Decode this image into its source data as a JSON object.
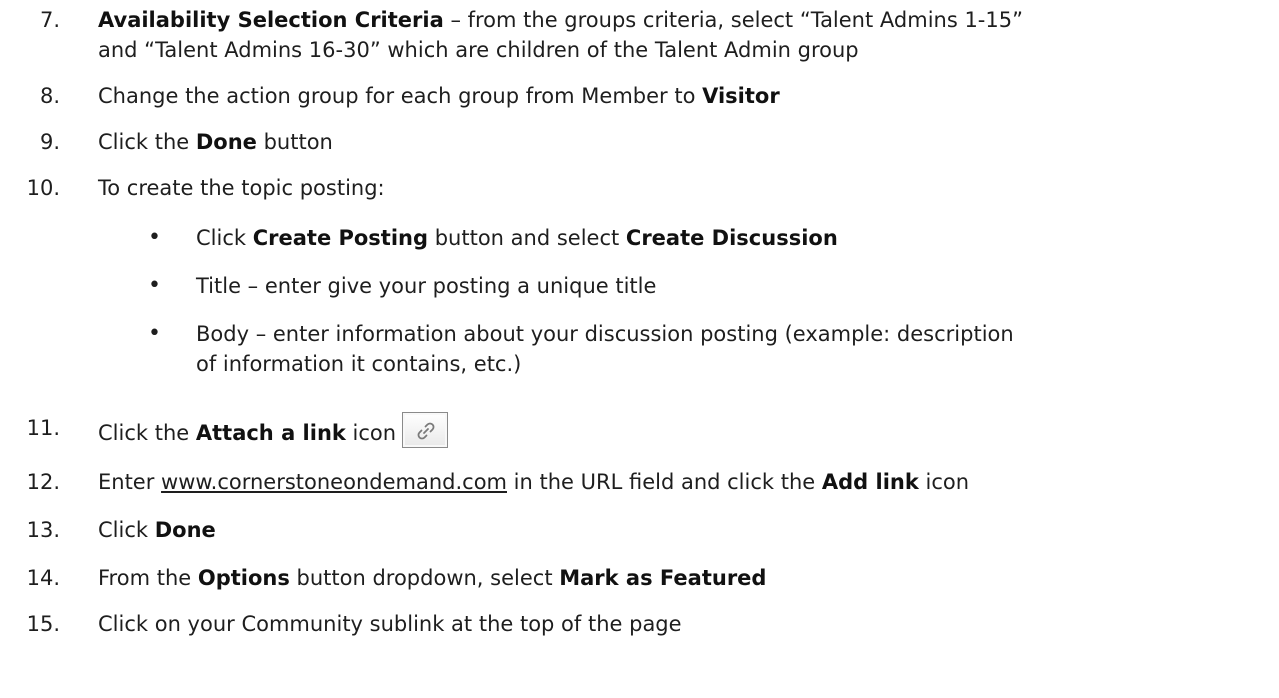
{
  "steps": [
    {
      "num": "7.",
      "bold": "Availability Selection Criteria",
      "rest_line1": " – from the groups criteria, select “Talent Admins 1-15”",
      "rest_line2": "and “Talent Admins 16-30” which are children of the Talent Admin group"
    },
    {
      "num": "8.",
      "pre": "Change the action group for each group from Member to ",
      "bold": "Visitor"
    },
    {
      "num": "9.",
      "pre": "Click the ",
      "bold": "Done",
      "post": " button"
    },
    {
      "num": "10.",
      "text": "To create the topic posting:"
    },
    {
      "num": "11.",
      "pre": "Click the ",
      "bold": "Attach a link",
      "post": " icon"
    },
    {
      "num": "12.",
      "pre": "Enter ",
      "link": "www.cornerstoneondemand.com",
      "mid": " in the URL field and click the ",
      "bold": "Add link",
      "post": " icon"
    },
    {
      "num": "13.",
      "pre": "Click ",
      "bold": "Done"
    },
    {
      "num": "14.",
      "pre": "From the ",
      "bold": "Options",
      "mid": " button dropdown, select ",
      "bold2": "Mark as Featured"
    },
    {
      "num": "15.",
      "text": "Click on your Community sublink at the top of the page"
    }
  ],
  "bullets": [
    {
      "pre": "Click ",
      "bold": "Create Posting",
      "mid": " button and select ",
      "bold2": "Create Discussion"
    },
    {
      "text": "Title – enter give your posting a unique title"
    },
    {
      "line1": "Body – enter information about your discussion posting (example: description",
      "line2": "of information it contains, etc.)"
    }
  ],
  "bullet_symbol": "•",
  "icons": {
    "attach_link": "link-icon"
  }
}
